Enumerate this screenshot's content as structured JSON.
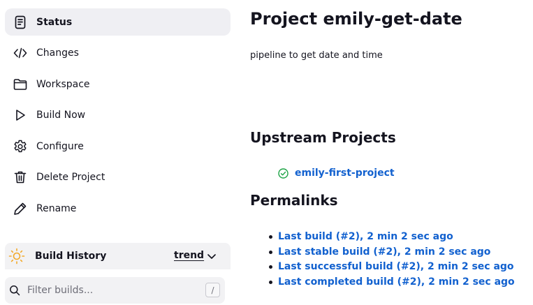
{
  "sidebar": {
    "items": [
      {
        "label": "Status",
        "icon": "status-document-icon",
        "active": true
      },
      {
        "label": "Changes",
        "icon": "code-brackets-icon"
      },
      {
        "label": "Workspace",
        "icon": "folder-icon"
      },
      {
        "label": "Build Now",
        "icon": "play-icon"
      },
      {
        "label": "Configure",
        "icon": "gear-icon"
      },
      {
        "label": "Delete Project",
        "icon": "trash-icon"
      },
      {
        "label": "Rename",
        "icon": "pencil-icon"
      }
    ],
    "build_history": {
      "title": "Build History",
      "trend_label": "trend",
      "icon": "sun-weather-icon",
      "icon_color": "#f3a929"
    },
    "filter": {
      "placeholder": "Filter builds...",
      "shortcut": "/"
    }
  },
  "main": {
    "title": "Project emily-get-date",
    "description": "pipeline to get date and time",
    "upstream": {
      "title": "Upstream Projects",
      "items": [
        {
          "label": "emily-first-project",
          "status": "success",
          "status_color": "#1ea446"
        }
      ]
    },
    "permalinks": {
      "title": "Permalinks",
      "items": [
        {
          "label": "Last build (#2), 2 min 2 sec ago"
        },
        {
          "label": "Last stable build (#2), 2 min 2 sec ago"
        },
        {
          "label": "Last successful build (#2), 2 min 2 sec ago"
        },
        {
          "label": "Last completed build (#2), 2 min 2 sec ago"
        }
      ]
    }
  },
  "colors": {
    "link": "#1261cf",
    "text": "#14141f",
    "active_bg": "#efeff3"
  }
}
